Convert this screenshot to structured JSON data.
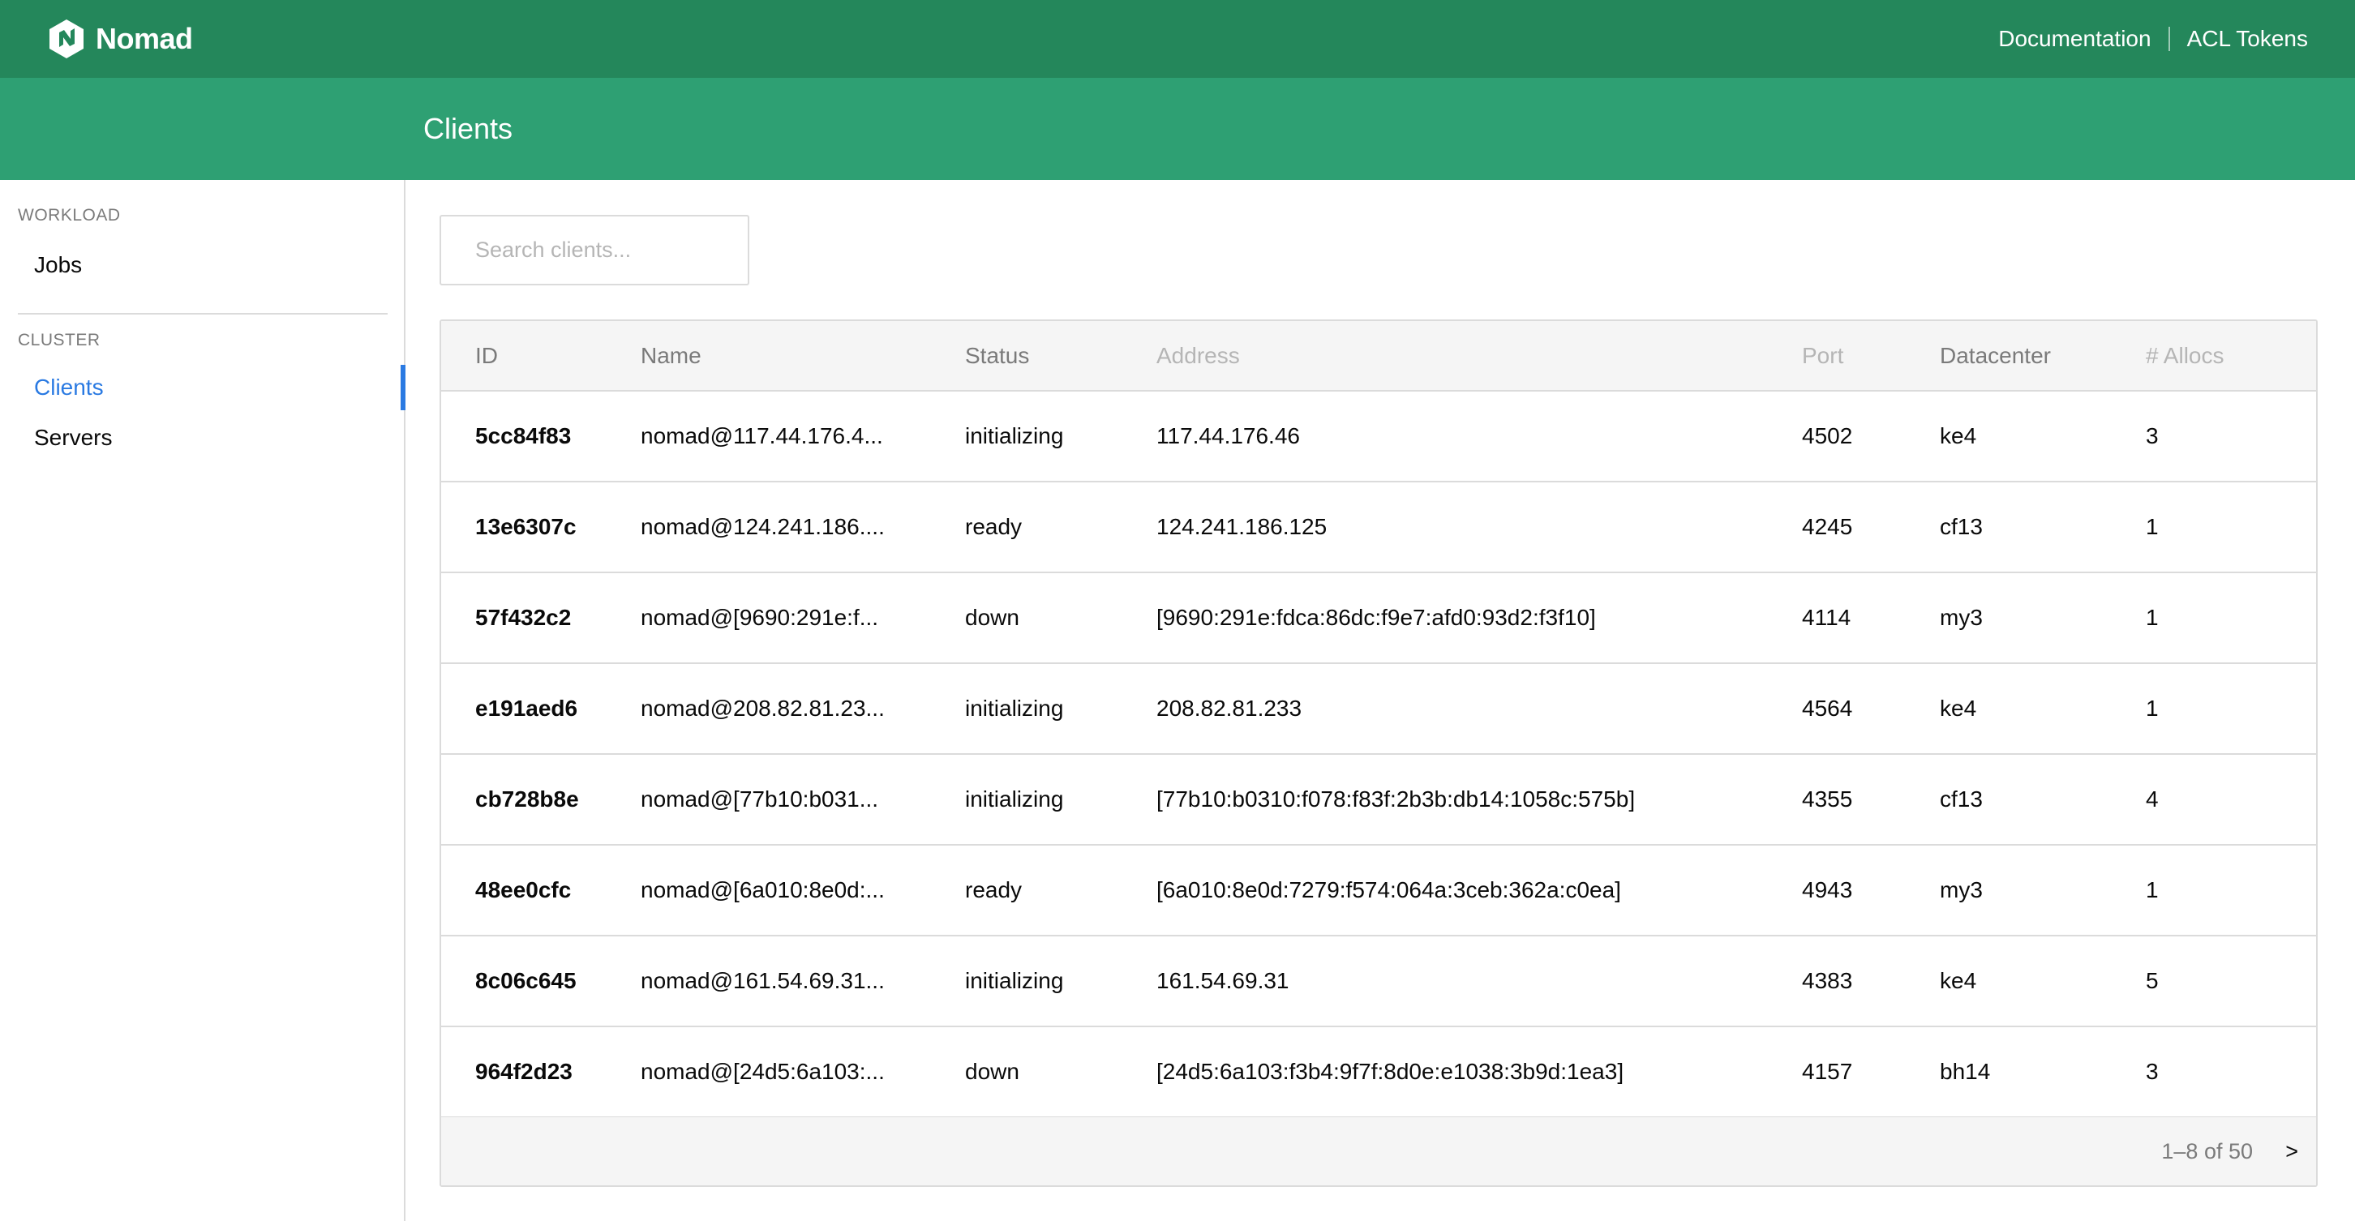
{
  "header": {
    "brand": "Nomad",
    "nav": [
      {
        "label": "Documentation"
      },
      {
        "label": "ACL Tokens"
      }
    ]
  },
  "page": {
    "title": "Clients"
  },
  "sidebar": {
    "sections": [
      {
        "label": "WORKLOAD",
        "items": [
          {
            "label": "Jobs"
          }
        ]
      },
      {
        "label": "CLUSTER",
        "items": [
          {
            "label": "Clients",
            "active": true
          },
          {
            "label": "Servers"
          }
        ]
      }
    ]
  },
  "search": {
    "placeholder": "Search clients...",
    "value": ""
  },
  "table": {
    "columns": [
      "ID",
      "Name",
      "Status",
      "Address",
      "Port",
      "Datacenter",
      "# Allocs"
    ],
    "rows": [
      {
        "id": "5cc84f83",
        "name": "nomad@117.44.176.4...",
        "status": "initializing",
        "address": "117.44.176.46",
        "port": "4502",
        "datacenter": "ke4",
        "allocs": "3"
      },
      {
        "id": "13e6307c",
        "name": "nomad@124.241.186....",
        "status": "ready",
        "address": "124.241.186.125",
        "port": "4245",
        "datacenter": "cf13",
        "allocs": "1"
      },
      {
        "id": "57f432c2",
        "name": "nomad@[9690:291e:f...",
        "status": "down",
        "address": "[9690:291e:fdca:86dc:f9e7:afd0:93d2:f3f10]",
        "port": "4114",
        "datacenter": "my3",
        "allocs": "1"
      },
      {
        "id": "e191aed6",
        "name": "nomad@208.82.81.23...",
        "status": "initializing",
        "address": "208.82.81.233",
        "port": "4564",
        "datacenter": "ke4",
        "allocs": "1"
      },
      {
        "id": "cb728b8e",
        "name": "nomad@[77b10:b031...",
        "status": "initializing",
        "address": "[77b10:b0310:f078:f83f:2b3b:db14:1058c:575b]",
        "port": "4355",
        "datacenter": "cf13",
        "allocs": "4"
      },
      {
        "id": "48ee0cfc",
        "name": "nomad@[6a010:8e0d:...",
        "status": "ready",
        "address": "[6a010:8e0d:7279:f574:064a:3ceb:362a:c0ea]",
        "port": "4943",
        "datacenter": "my3",
        "allocs": "1"
      },
      {
        "id": "8c06c645",
        "name": "nomad@161.54.69.31...",
        "status": "initializing",
        "address": "161.54.69.31",
        "port": "4383",
        "datacenter": "ke4",
        "allocs": "5"
      },
      {
        "id": "964f2d23",
        "name": "nomad@[24d5:6a103:...",
        "status": "down",
        "address": "[24d5:6a103:f3b4:9f7f:8d0e:e1038:3b9d:1ea3]",
        "port": "4157",
        "datacenter": "bh14",
        "allocs": "3"
      }
    ]
  },
  "pagination": {
    "info": "1–8 of 50",
    "next_label": ">"
  },
  "colors": {
    "header": "#24875b",
    "subheader": "#2ea073",
    "active": "#2a7ae2"
  },
  "icons": {
    "brand": "nomad-logo-icon"
  }
}
